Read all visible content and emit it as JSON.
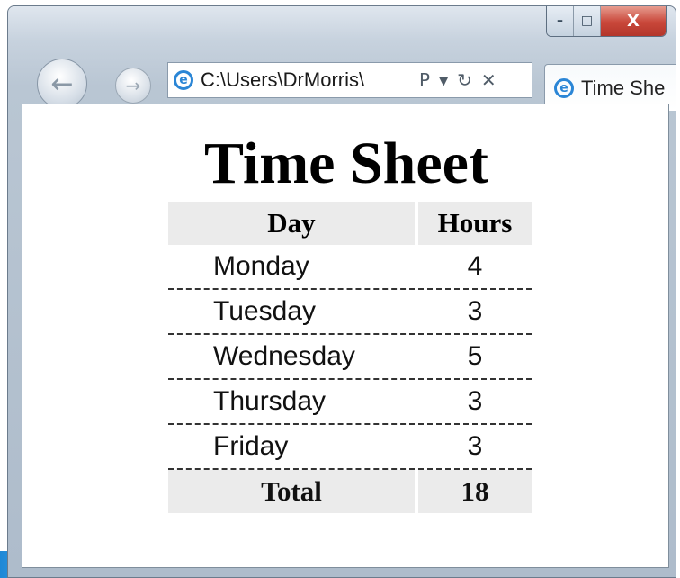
{
  "browser": {
    "address": "C:\\Users\\DrMorris\\",
    "tab_title": "Time She",
    "minimize_glyph": "–",
    "maximize_glyph": "□",
    "close_glyph": "X",
    "back_glyph": "←",
    "forward_glyph": "→",
    "search_glyph": "Ρ",
    "dropdown_glyph": "▾",
    "refresh_glyph": "↻",
    "stop_glyph": "✕",
    "ie_glyph": "e"
  },
  "page": {
    "title": "Time Sheet",
    "headers": [
      "Day",
      "Hours"
    ],
    "rows": [
      {
        "day": "Monday",
        "hours": "4"
      },
      {
        "day": "Tuesday",
        "hours": "3"
      },
      {
        "day": "Wednesday",
        "hours": "5"
      },
      {
        "day": "Thursday",
        "hours": "3"
      },
      {
        "day": "Friday",
        "hours": "3"
      }
    ],
    "total_label": "Total",
    "total_value": "18"
  },
  "colors": {
    "header_bg": "#ebebeb",
    "close_button": "#c9473a",
    "ie_blue": "#2b86d6"
  }
}
